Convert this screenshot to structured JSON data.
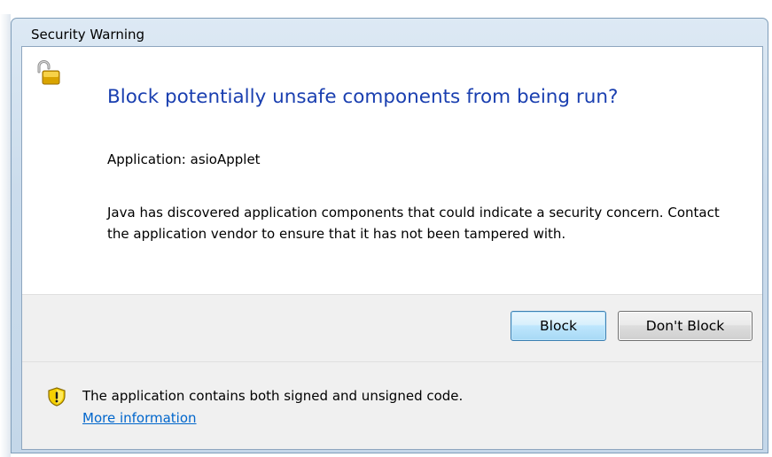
{
  "window": {
    "title": "Security Warning"
  },
  "dialog": {
    "heading": "Block potentially unsafe components from being run?",
    "application_label": "Application:",
    "application_name": "asioApplet",
    "application_line": "Application: asioApplet",
    "description": "Java has discovered application components that could indicate a security concern. Contact the application vendor to ensure that it has not been tampered with.",
    "heading_icon": "unlocked-padlock-icon"
  },
  "buttons": {
    "block_label": "Block",
    "dont_block_label": "Don't Block"
  },
  "footer": {
    "icon": "warning-shield-icon",
    "message": "The application contains both signed and unsigned code.",
    "link_label": "More information"
  },
  "colors": {
    "heading": "#1a3fb0",
    "link": "#0066cc",
    "panel_background": "#f0f0f0",
    "default_button_border": "#3c7fb1"
  }
}
